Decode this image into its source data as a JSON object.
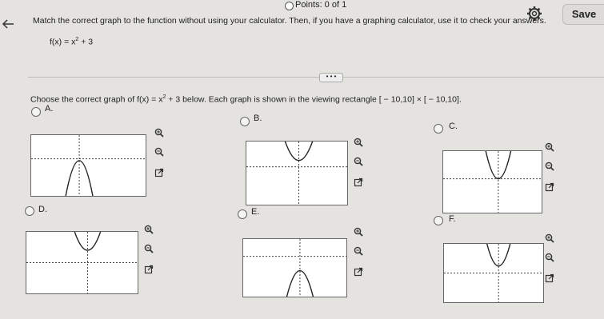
{
  "header": {
    "points_label": "Points: 0 of 1",
    "save_label": "Save"
  },
  "question": {
    "instructions": "Match the correct graph to the function without using your calculator. Then, if you have a graphing calculator, use it to check your answers.",
    "function_prefix": "f(x) = x",
    "function_exponent": "2",
    "function_suffix": " + 3",
    "ellipsis": "• • •",
    "prompt_prefix": "Choose the correct graph of f(x) = x",
    "prompt_exponent": "2",
    "prompt_suffix": " + 3 below. Each graph is shown in the viewing rectangle [ − 10,10] × [ − 10,10]."
  },
  "choices": [
    {
      "label": "A.",
      "curve": "down_below_axis",
      "selected": false
    },
    {
      "label": "B.",
      "curve": "up_vertex_near_axis_top",
      "selected": false
    },
    {
      "label": "C.",
      "curve": "up_vertex_on_axis",
      "selected": false
    },
    {
      "label": "D.",
      "curve": "up_vertex_above_axis",
      "selected": false
    },
    {
      "label": "E.",
      "curve": "down_vertex_below_axis",
      "selected": false
    },
    {
      "label": "F.",
      "curve": "up_vertex_above_axis_narrow",
      "selected": false
    }
  ],
  "icons": {
    "zoom_in": "zoom-in-icon",
    "zoom_out": "zoom-out-icon",
    "popout": "external-link-icon"
  }
}
